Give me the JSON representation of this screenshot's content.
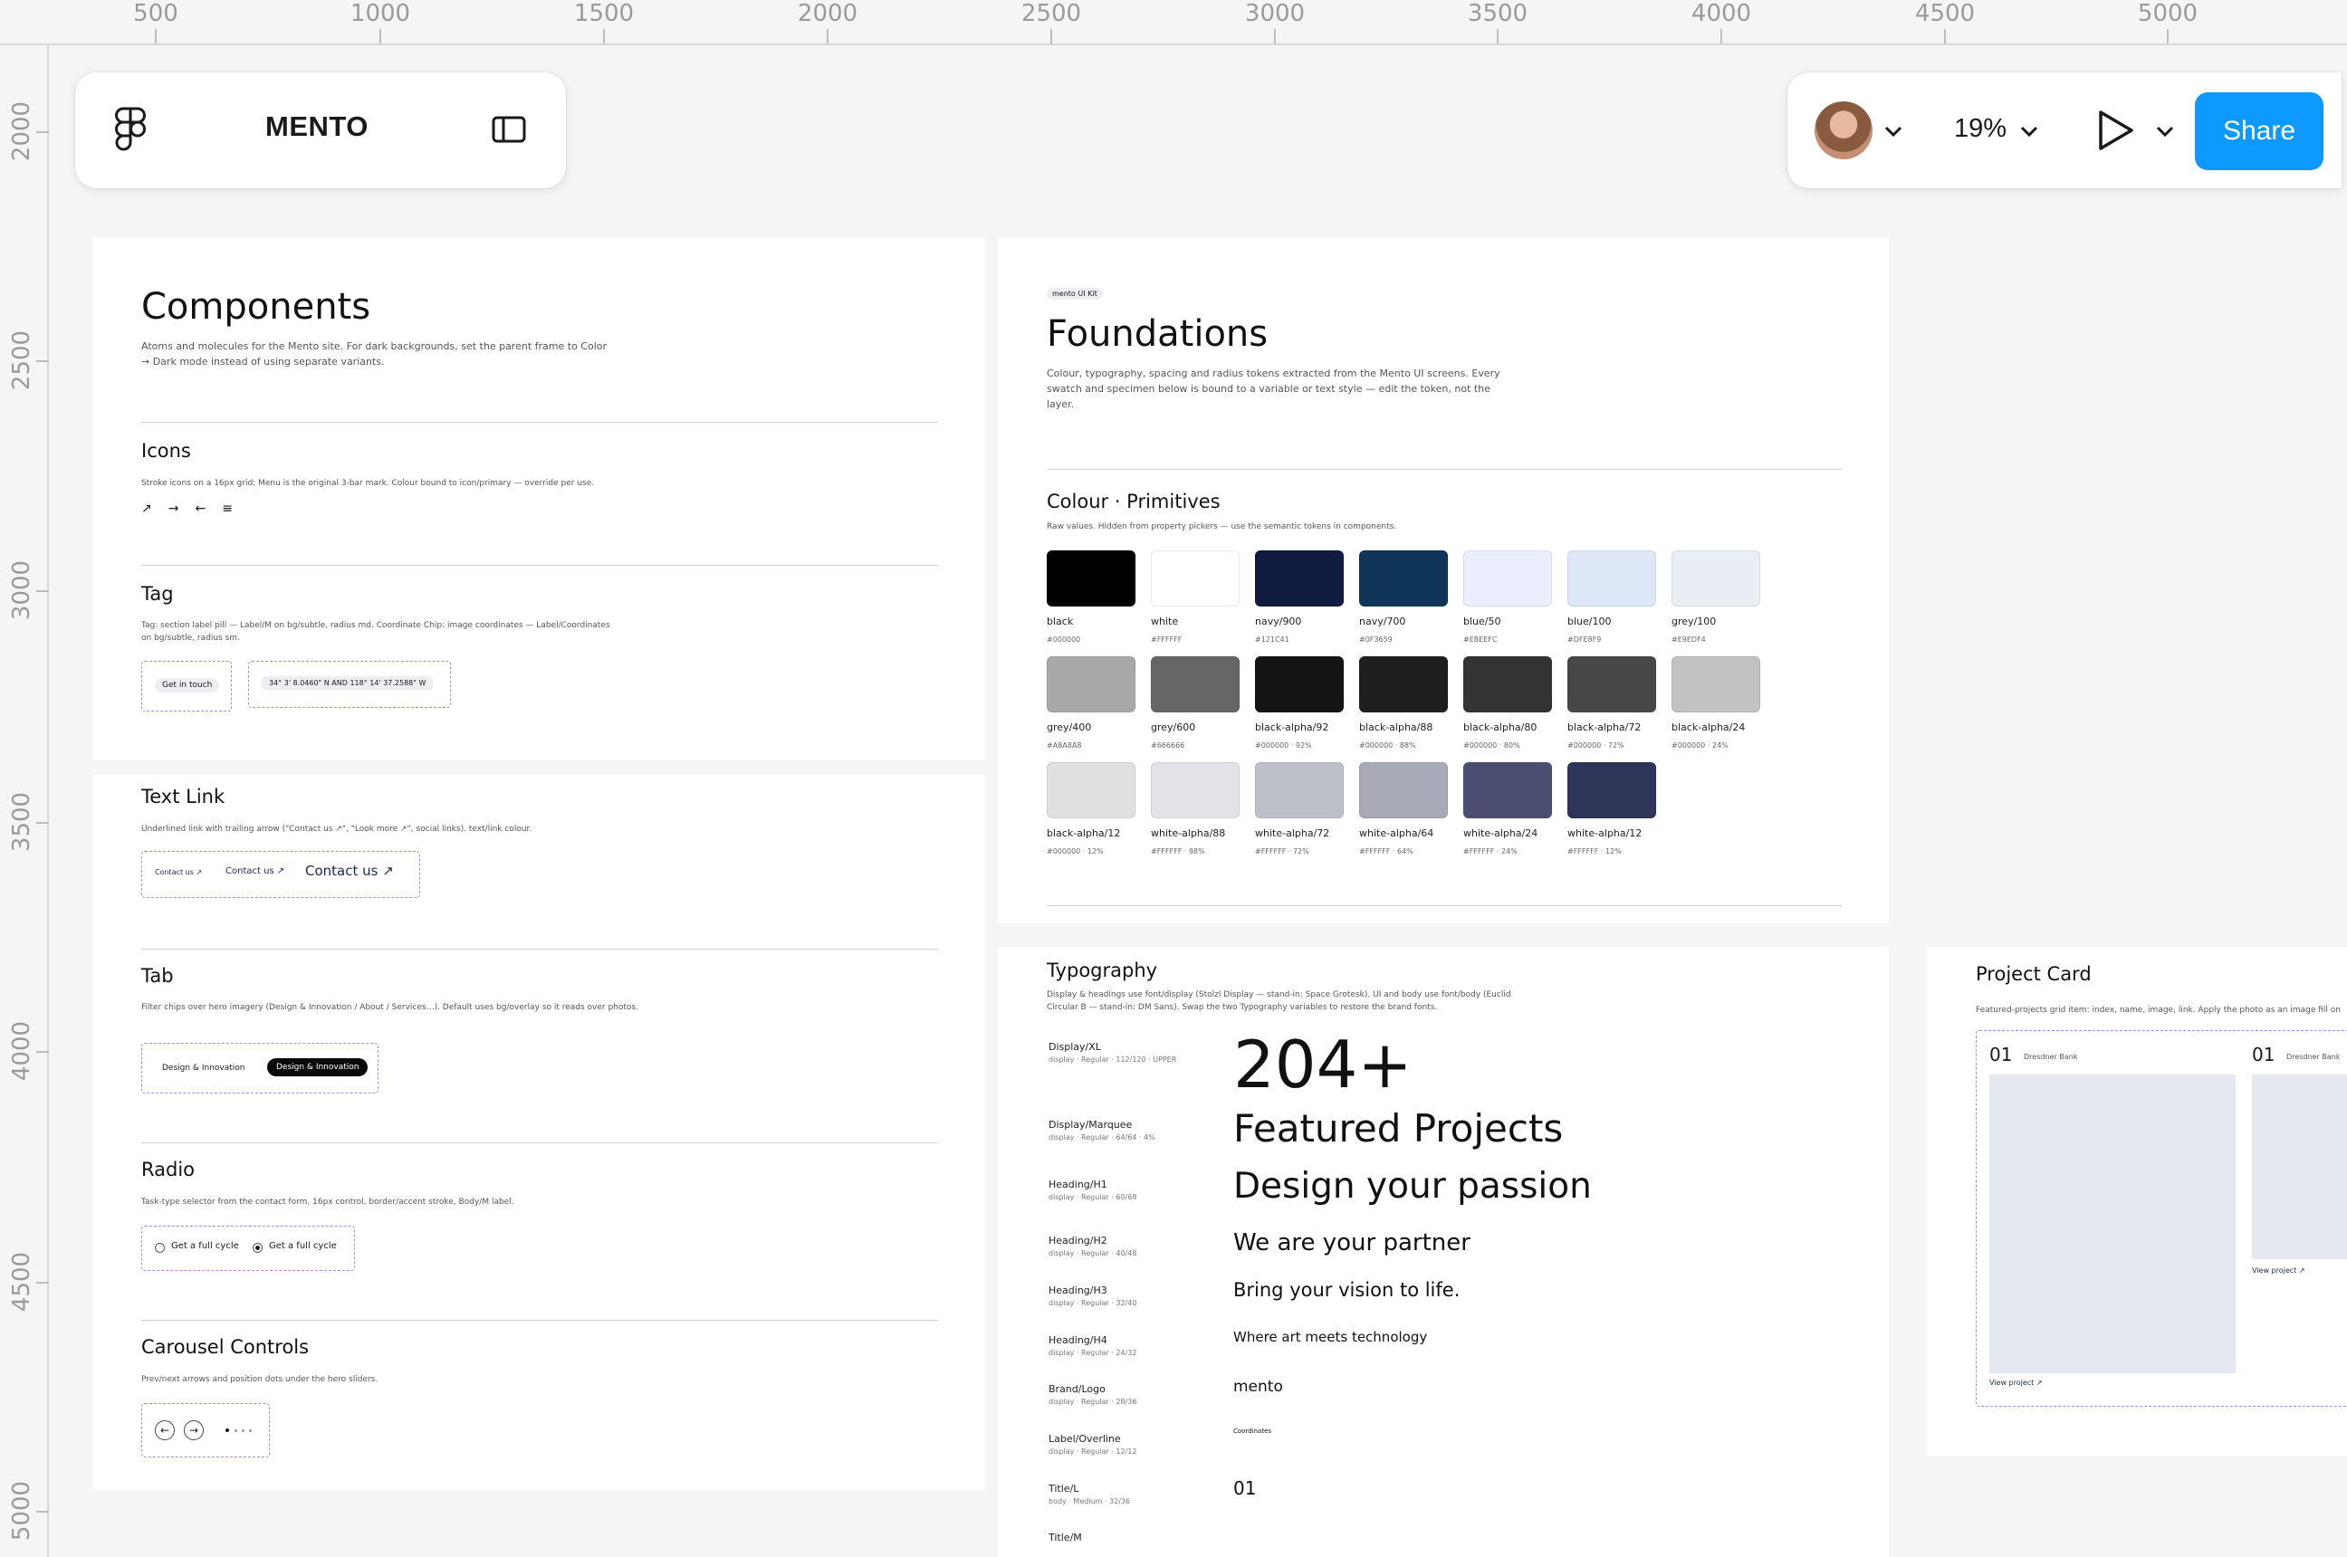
{
  "ruler": {
    "top": [
      "500",
      "1000",
      "1500",
      "2000",
      "2500",
      "3000",
      "3500",
      "4000",
      "4500",
      "5000"
    ],
    "left": [
      "2000",
      "2500",
      "3000",
      "3500",
      "4000",
      "4500",
      "5000"
    ]
  },
  "toolbar": {
    "file_name": "MENTO",
    "zoom": "19%",
    "share_label": "Share"
  },
  "components": {
    "title": "Components",
    "desc": "Atoms and molecules for the Mento site. For dark backgrounds, set the parent frame to Color → Dark mode instead of using separate variants.",
    "icons": {
      "title": "Icons",
      "desc": "Stroke icons on a 16px grid; Menu is the original 3-bar mark. Colour bound to icon/primary — override per use.",
      "glyphs": [
        "↗",
        "→",
        "←",
        "≡"
      ]
    },
    "tag": {
      "title": "Tag",
      "desc": "Tag: section label pill — Label/M on bg/subtle, radius md. Coordinate Chip: image coordinates — Label/Coordinates on bg/subtle, radius sm.",
      "pill": "Get in touch",
      "chip": "34° 3' 8.0460\" N AND 118° 14' 37.2588\" W"
    },
    "text_link": {
      "title": "Text Link",
      "desc": "Underlined link with trailing arrow (\"Contact us ↗\", \"Look more ↗\", social links). text/link colour.",
      "links": [
        "Contact us ↗",
        "Contact us ↗",
        "Contact us ↗"
      ]
    },
    "tab": {
      "title": "Tab",
      "desc": "Filter chips over hero imagery (Design & Innovation / About / Services…). Default uses bg/overlay so it reads over photos.",
      "default": "Design & Innovation",
      "active": "Design & Innovation"
    },
    "radio": {
      "title": "Radio",
      "desc": "Task-type selector from the contact form. 16px control, border/accent stroke, Body/M label.",
      "options": [
        "Get a full cycle",
        "Get a full cycle"
      ]
    },
    "carousel": {
      "title": "Carousel Controls",
      "desc": "Prev/next arrows and position dots under the hero sliders."
    }
  },
  "foundations": {
    "tag": "mento UI Kit",
    "title": "Foundations",
    "desc": "Colour, typography, spacing and radius tokens extracted from the Mento UI screens. Every swatch and specimen below is bound to a variable or text style — edit the token, not the layer.",
    "primitives_title": "Colour · Primitives",
    "primitives_desc": "Raw values. Hidden from property pickers — use the semantic tokens in components.",
    "swatches": [
      {
        "name": "black",
        "value": "#000000",
        "color": "#000000"
      },
      {
        "name": "white",
        "value": "#FFFFFF",
        "color": "#FFFFFF"
      },
      {
        "name": "navy/900",
        "value": "#121C41",
        "color": "#121C41"
      },
      {
        "name": "navy/700",
        "value": "#0F3659",
        "color": "#0F3659"
      },
      {
        "name": "blue/50",
        "value": "#EBEEFC",
        "color": "#EBEEFC"
      },
      {
        "name": "blue/100",
        "value": "#DFE8F9",
        "color": "#DFE8F9"
      },
      {
        "name": "grey/100",
        "value": "#E9EDF4",
        "color": "#E9EDF4"
      },
      {
        "name": "grey/400",
        "value": "#A8A8A8",
        "color": "#A8A8A8"
      },
      {
        "name": "grey/600",
        "value": "#666666",
        "color": "#666666"
      },
      {
        "name": "black-alpha/92",
        "value": "#000000 · 92%",
        "color": "#141414"
      },
      {
        "name": "black-alpha/88",
        "value": "#000000 · 88%",
        "color": "#1F1F1F"
      },
      {
        "name": "black-alpha/80",
        "value": "#000000 · 80%",
        "color": "#333333"
      },
      {
        "name": "black-alpha/72",
        "value": "#000000 · 72%",
        "color": "#474747"
      },
      {
        "name": "black-alpha/24",
        "value": "#000000 · 24%",
        "color": "#C2C2C2"
      },
      {
        "name": "black-alpha/12",
        "value": "#000000 · 12%",
        "color": "#E0E0E0"
      },
      {
        "name": "white-alpha/88",
        "value": "#FFFFFF · 88%",
        "color": "#E2E3E6"
      },
      {
        "name": "white-alpha/72",
        "value": "#FFFFFF · 72%",
        "color": "#BDBFC9"
      },
      {
        "name": "white-alpha/64",
        "value": "#FFFFFF · 64%",
        "color": "#A7A9B7"
      },
      {
        "name": "white-alpha/24",
        "value": "#FFFFFF · 24%",
        "color": "#4B5073"
      },
      {
        "name": "white-alpha/12",
        "value": "#FFFFFF · 12%",
        "color": "#2E3558"
      }
    ]
  },
  "typography": {
    "title": "Typography",
    "desc": "Display & headings use font/display (Stolzl Display — stand-in: Space Grotesk). UI and body use font/body (Euclid Circular B — stand-in: DM Sans). Swap the two Typography variables to restore the brand fonts.",
    "rows": [
      {
        "name": "Display/XL",
        "meta": "display · Regular · 112/120 · UPPER",
        "sample": "204+",
        "size": 72
      },
      {
        "name": "Display/Marquee",
        "meta": "display · Regular · 64/64 · 4%",
        "sample": "Featured Projects",
        "size": 42
      },
      {
        "name": "Heading/H1",
        "meta": "display · Regular · 60/68",
        "sample": "Design your passion",
        "size": 39
      },
      {
        "name": "Heading/H2",
        "meta": "display · Regular · 40/48",
        "sample": "We are your partner",
        "size": 26
      },
      {
        "name": "Heading/H3",
        "meta": "display · Regular · 32/40",
        "sample": "Bring your vision to life.",
        "size": 21
      },
      {
        "name": "Heading/H4",
        "meta": "display · Regular · 24/32",
        "sample": "Where art meets technology",
        "size": 15
      },
      {
        "name": "Brand/Logo",
        "meta": "display · Regular · 28/36",
        "sample": "mento",
        "size": 17
      },
      {
        "name": "Label/Overline",
        "meta": "display · Regular · 12/12",
        "sample": "Coordinates",
        "size": 7
      },
      {
        "name": "Title/L",
        "meta": "body · Medium · 32/36",
        "sample": "01",
        "size": 20
      },
      {
        "name": "Title/M",
        "meta": "",
        "sample": "",
        "size": 14
      }
    ]
  },
  "project_card": {
    "title": "Project Card",
    "desc": "Featured-projects grid item: index, name, image, link. Apply the photo as an image fill on",
    "cards": [
      {
        "index": "01",
        "name": "Dresdner Bank",
        "link": "View project ↗"
      },
      {
        "index": "01",
        "name": "Dresdner Bank",
        "link": "View project ↗"
      }
    ]
  }
}
